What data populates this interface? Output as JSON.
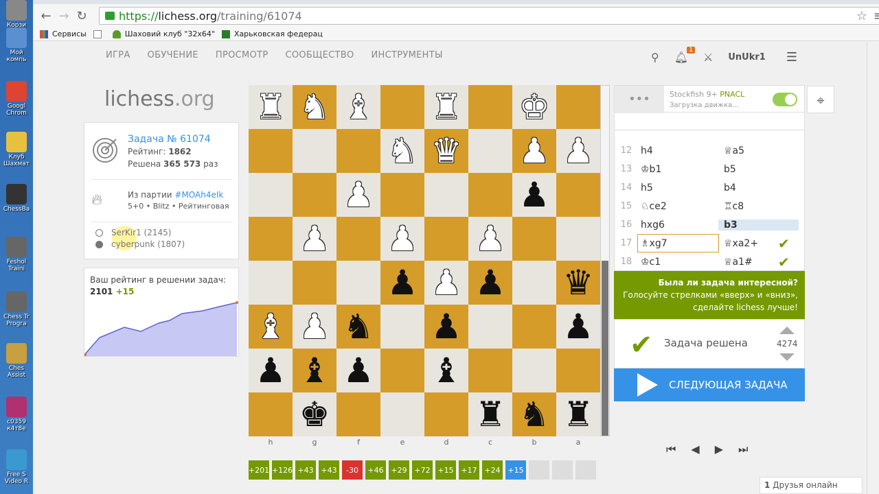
{
  "desktop": {
    "icons": [
      "Корзи",
      "Мой компь",
      "Googl Chrom",
      "Клуб Шахмат",
      "ChessBa",
      "Feshol Traini",
      "Chess Tr Progra",
      "Ches Assist",
      "c0359 к4т8e",
      "Free S Video R"
    ]
  },
  "browser": {
    "url_scheme": "https://",
    "url_host": "lichess.org",
    "url_path": "/training/61074",
    "bookmarks": [
      "Сервисы",
      "Шаховий клуб \"32x64\"",
      "Харьковская федерац"
    ]
  },
  "nav": {
    "items": [
      "ИГРА",
      "ОБУЧЕНИЕ",
      "ПРОСМОТР",
      "СООБЩЕСТВО",
      "ИНСТРУМЕНТЫ"
    ],
    "notif_count": "1",
    "username": "UnUkr1"
  },
  "logo": {
    "main": "lichess",
    "tld": ".org"
  },
  "puzzle": {
    "title": "Задача № 61074",
    "rating_label": "Рейтинг: ",
    "rating": "1862",
    "solved_label": "Решена ",
    "solved_count": "365 573",
    "solved_suffix": " раз",
    "from_game_label": "Из партии ",
    "game_id": "#MOAh4eIk",
    "game_meta": "5+0 • Blitz • Рейтинговая",
    "white_player": "SerKir1 (2145)",
    "black_player": "cyberpunk (1807)"
  },
  "my_rating": {
    "label": "Ваш рейтинг в решении задач:",
    "value": "2101",
    "delta": "+15"
  },
  "board": {
    "files": [
      "h",
      "g",
      "f",
      "e",
      "d",
      "c",
      "b",
      "a"
    ],
    "ranks": [
      [
        "wR",
        "wN",
        "wB",
        "",
        "wR",
        "",
        "wK",
        ""
      ],
      [
        "",
        "",
        "",
        "wN",
        "wQ",
        "",
        "wP",
        "wP"
      ],
      [
        "",
        "",
        "wP",
        "",
        "",
        "",
        "bP",
        ""
      ],
      [
        "",
        "wP",
        "",
        "wP",
        "",
        "wP",
        "",
        ""
      ],
      [
        "",
        "",
        "",
        "bP",
        "wP",
        "bP",
        "",
        "bQ"
      ],
      [
        "wB",
        "wP",
        "bN",
        "",
        "bP",
        "",
        "",
        "bP"
      ],
      [
        "bP",
        "bB",
        "bP",
        "",
        "bB",
        "",
        "",
        ""
      ],
      [
        "",
        "bK",
        "",
        "",
        "",
        "bR",
        "bN",
        "bR"
      ]
    ]
  },
  "eval_bar": [
    "+201",
    "+126",
    "+43",
    "+43",
    "-30",
    "+46",
    "+29",
    "+72",
    "+15",
    "+17",
    "+24",
    "+15",
    "",
    "",
    ""
  ],
  "engine": {
    "dots": "•••",
    "name": "Stockfish 9+",
    "variant": "PNACL",
    "status": "Загрузка движка..."
  },
  "moves": [
    {
      "no": "12",
      "white": "h4",
      "black": "♕a5"
    },
    {
      "no": "13",
      "white": "♔b1",
      "black": "b5"
    },
    {
      "no": "14",
      "white": "h5",
      "black": "b4"
    },
    {
      "no": "15",
      "white": "♘ce2",
      "black": "♖c8"
    },
    {
      "no": "16",
      "white": "hxg6",
      "black": "b3"
    },
    {
      "no": "17",
      "white": "♗xg7",
      "black": "♕xa2+"
    },
    {
      "no": "18",
      "white": "♔c1",
      "black": "♕a1#"
    }
  ],
  "feedback": {
    "title": "Была ли задача интересной?",
    "line2": "Голосуйте стрелками «вверх» и «вниз»,",
    "line3": "сделайте lichess лучше!"
  },
  "solved": {
    "text": "Задача решена",
    "votes": "4274"
  },
  "next_button": "СЛЕДУЮЩАЯ ЗАДАЧА",
  "friends": {
    "count": "1",
    "label": " Друзья онлайн"
  },
  "colors": {
    "green": "#759900",
    "blue": "#3692e7",
    "dark_square": "#d69c2a",
    "light_square": "#e8e5df"
  }
}
